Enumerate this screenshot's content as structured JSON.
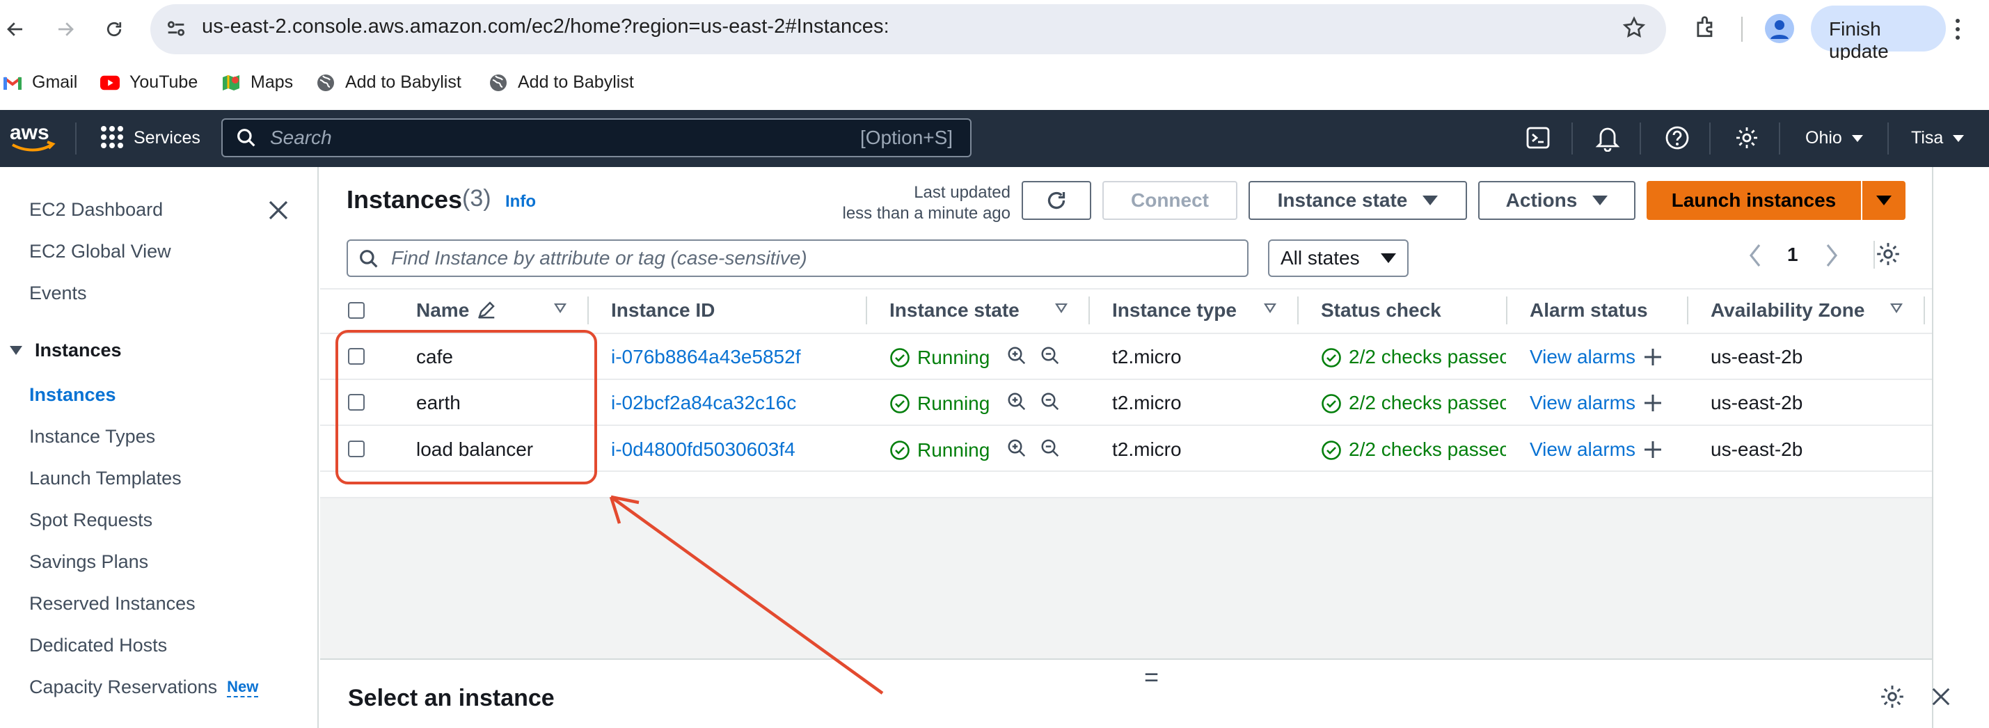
{
  "browser": {
    "url": "us-east-2.console.aws.amazon.com/ec2/home?region=us-east-2#Instances:",
    "finish_update_label": "Finish update",
    "bookmarks": [
      {
        "label": "Gmail",
        "icon": "gmail-icon"
      },
      {
        "label": "YouTube",
        "icon": "youtube-icon"
      },
      {
        "label": "Maps",
        "icon": "maps-icon"
      },
      {
        "label": "Add to Babylist",
        "icon": "globe-icon"
      },
      {
        "label": "Add to Babylist",
        "icon": "globe-icon"
      }
    ]
  },
  "aws_header": {
    "logo": "aws",
    "services_label": "Services",
    "search_placeholder": "Search",
    "search_shortcut": "[Option+S]",
    "region": "Ohio",
    "user": "Tisa",
    "icons": [
      "cloudshell-icon",
      "bell-icon",
      "help-icon",
      "settings-icon"
    ]
  },
  "sidebar": {
    "top_items": [
      "EC2 Dashboard",
      "EC2 Global View",
      "Events"
    ],
    "section_label": "Instances",
    "section_items": [
      {
        "label": "Instances",
        "active": true
      },
      {
        "label": "Instance Types",
        "active": false
      },
      {
        "label": "Launch Templates",
        "active": false
      },
      {
        "label": "Spot Requests",
        "active": false
      },
      {
        "label": "Savings Plans",
        "active": false
      },
      {
        "label": "Reserved Instances",
        "active": false
      },
      {
        "label": "Dedicated Hosts",
        "active": false
      },
      {
        "label": "Capacity Reservations",
        "active": false,
        "badge": "New"
      }
    ]
  },
  "page": {
    "title": "Instances",
    "count": "(3)",
    "info_link": "Info",
    "last_updated_line1": "Last updated",
    "last_updated_line2": "less than a minute ago",
    "connect_label": "Connect",
    "instance_state_label": "Instance state",
    "actions_label": "Actions",
    "launch_label": "Launch instances",
    "filter_placeholder": "Find Instance by attribute or tag (case-sensitive)",
    "states_filter": "All states",
    "page_number": "1"
  },
  "table": {
    "columns": [
      "Name",
      "Instance ID",
      "Instance state",
      "Instance type",
      "Status check",
      "Alarm status",
      "Availability Zone"
    ],
    "rows": [
      {
        "name": "cafe",
        "id": "i-076b8864a43e5852f",
        "state": "Running",
        "type": "t2.micro",
        "status": "2/2 checks passec",
        "alarm": "View alarms",
        "az": "us-east-2b"
      },
      {
        "name": "earth",
        "id": "i-02bcf2a84ca32c16c",
        "state": "Running",
        "type": "t2.micro",
        "status": "2/2 checks passec",
        "alarm": "View alarms",
        "az": "us-east-2b"
      },
      {
        "name": "load balancer",
        "id": "i-0d4800fd5030603f4",
        "state": "Running",
        "type": "t2.micro",
        "status": "2/2 checks passec",
        "alarm": "View alarms",
        "az": "us-east-2b"
      }
    ]
  },
  "split_panel": {
    "title": "Select an instance",
    "drag_handle": "="
  },
  "colors": {
    "aws_header": "#232f3e",
    "primary": "#ec7211",
    "link": "#0972d3",
    "success": "#037f0c",
    "annotation": "#e34a2f"
  }
}
